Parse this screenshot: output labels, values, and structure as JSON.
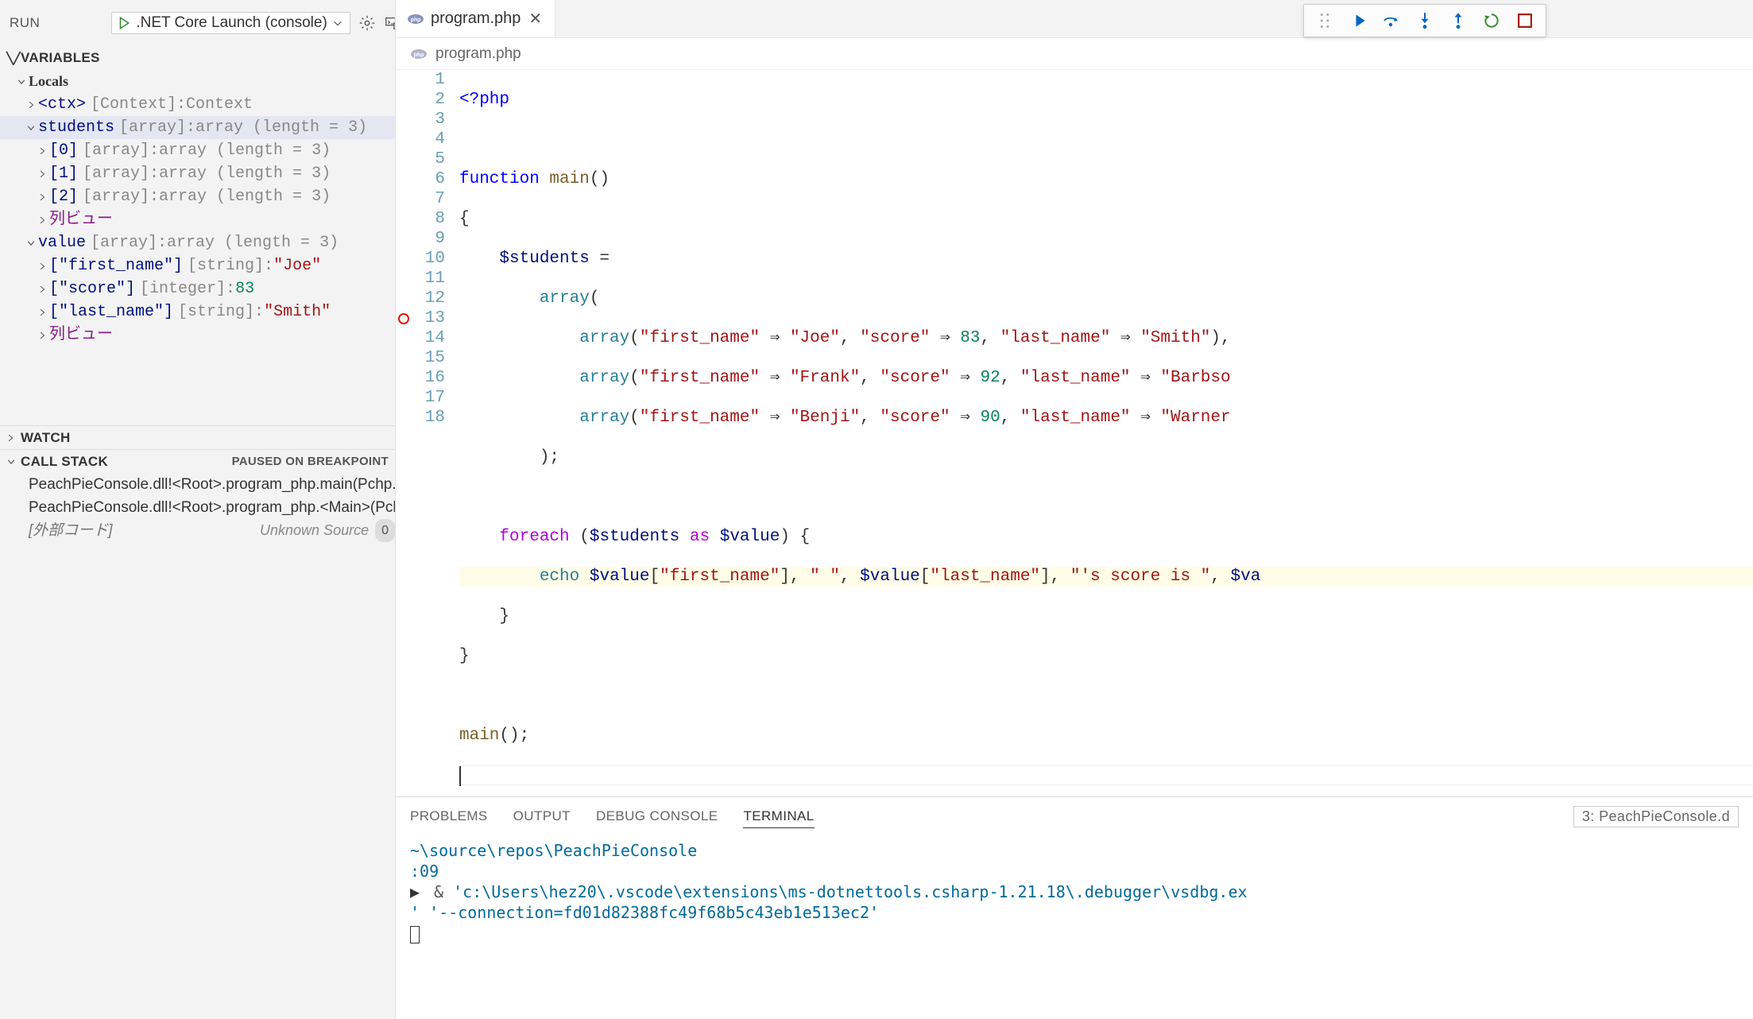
{
  "run_header": {
    "label": "RUN",
    "launch_config": ".NET Core Launch (console)"
  },
  "sections": {
    "variables": "VARIABLES",
    "locals": "Locals",
    "watch": "WATCH",
    "callstack": "CALL STACK",
    "callstack_status": "PAUSED ON BREAKPOINT"
  },
  "vars": {
    "ctx_name": "<ctx>",
    "ctx_type": "[Context]:",
    "ctx_val": "Context",
    "students_name": "students",
    "students_type": "[array]:",
    "arr_len3": "array (length = 3)",
    "idx0": "[0]",
    "idx1": "[1]",
    "idx2": "[2]",
    "arrtype": "[array]:",
    "column_view": "列ビュー",
    "value_name": "value",
    "fn_key": "[\"first_name\"]",
    "sc_key": "[\"score\"]",
    "ln_key": "[\"last_name\"]",
    "str_type": "[string]:",
    "int_type": "[integer]:",
    "joe": "\"Joe\"",
    "score83": "83",
    "smith": "\"Smith\""
  },
  "callstack": {
    "frame0": "PeachPieConsole.dll!<Root>.program_php.main(Pchp.",
    "frame1": "PeachPieConsole.dll!<Root>.program_php.<Main>(Pchp",
    "external": "[外部コード]",
    "unknown_src": "Unknown Source",
    "badge": "0"
  },
  "tab": {
    "filename": "program.php"
  },
  "breadcrumb": {
    "file": "program.php"
  },
  "code": {
    "l1": "<?php",
    "l3_a": "function",
    "l3_b": " main",
    "l3_c": "()",
    "l4": "{",
    "l5_a": "    $students",
    "l5_b": " =",
    "l6": "        array(",
    "l7_a": "            array(",
    "l7_fn": "\"first_name\"",
    "l7_arr": " ⇒ ",
    "l7_joe": "\"Joe\"",
    "l7_c1": ", ",
    "l7_sc": "\"score\"",
    "l7_83": "83",
    "l7_ln": "\"last_name\"",
    "l7_sm": "\"Smith\"",
    "l7_end": "),",
    "l8_frank": "\"Frank\"",
    "l8_92": "92",
    "l8_barb": "\"Barbso",
    "l9_benji": "\"Benji\"",
    "l9_90": "90",
    "l9_warner": "\"Warner",
    "l10": "        );",
    "l12_a": "    foreach",
    "l12_b": " ($students ",
    "l12_as": "as",
    "l12_c": " $value) {",
    "l13_a": "        echo",
    "l13_b": " $value[",
    "l13_fn": "\"first_name\"",
    "l13_c": "], ",
    "l13_sp": "\" \"",
    "l13_d": ", $value[",
    "l13_ln": "\"last_name\"",
    "l13_e": "], ",
    "l13_msg": "\"'s score is \"",
    "l13_f": ", $va",
    "l14": "    }",
    "l15": "}",
    "l17_a": "main",
    "l17_b": "();"
  },
  "line_nums": [
    "1",
    "2",
    "3",
    "4",
    "5",
    "6",
    "7",
    "8",
    "9",
    "10",
    "11",
    "12",
    "13",
    "14",
    "15",
    "16",
    "17",
    "18"
  ],
  "panel": {
    "tabs": {
      "problems": "PROBLEMS",
      "output": "OUTPUT",
      "debug_console": "DEBUG CONSOLE",
      "terminal": "TERMINAL"
    },
    "terminal_select": "3: PeachPieConsole.d"
  },
  "terminal": {
    "line1": "~\\source\\repos\\PeachPieConsole",
    "line2": ":09",
    "line3_pre": "& ",
    "line3": "'c:\\Users\\hez20\\.vscode\\extensions\\ms-dotnettools.csharp-1.21.18\\.debugger\\vsdbg.ex",
    "line4_pre": "' ",
    "line4": "'--connection=fd01d82388fc49f68b5c43eb1e513ec2'"
  },
  "debug_toolbar": {
    "continue": "continue",
    "step_over": "step-over",
    "step_into": "step-into",
    "step_out": "step-out",
    "restart": "restart",
    "stop": "stop"
  }
}
